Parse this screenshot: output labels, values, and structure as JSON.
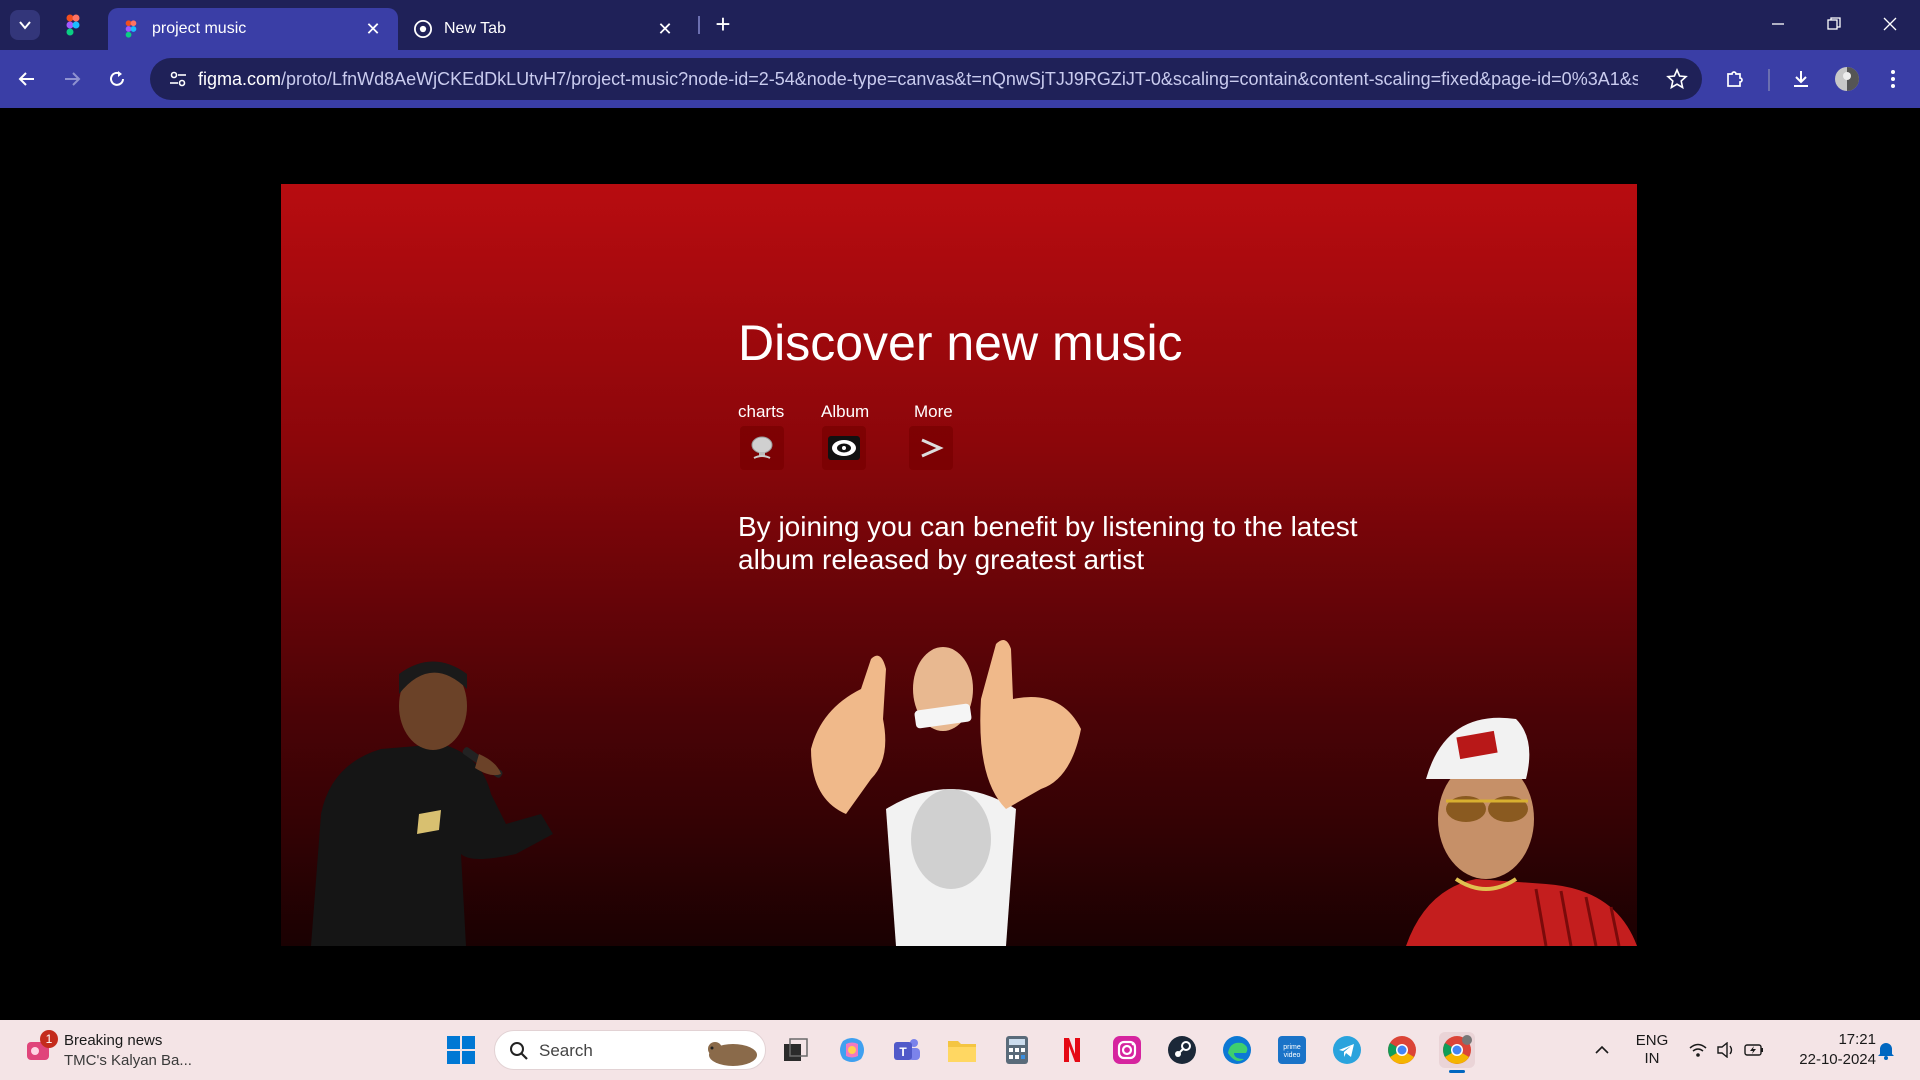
{
  "browser": {
    "tabs": [
      {
        "title": "project music",
        "active": true
      },
      {
        "title": "New Tab",
        "active": false
      }
    ],
    "url_host": "figma.com",
    "url_path": "/proto/LfnWd8AeWjCKEdDkLUtvH7/project-music?node-id=2-54&node-type=canvas&t=nQnwSjTJJ9RGZiJT-0&scaling=contain&content-scaling=fixed&page-id=0%3A1&star..."
  },
  "page": {
    "headline": "Discover new music",
    "categories": [
      {
        "label": "charts",
        "icon": "microphone-icon"
      },
      {
        "label": "Album",
        "icon": "vinyl-disc-icon"
      },
      {
        "label": "More",
        "icon": "arrow-right-icon"
      }
    ],
    "blurb": "By joining you can benefit by listening to the latest album released by greatest artist"
  },
  "taskbar": {
    "news_badge": "1",
    "news_title": "Breaking news",
    "news_subtitle": "TMC's Kalyan Ba...",
    "search_label": "Search",
    "lang_line1": "ENG",
    "lang_line2": "IN",
    "time": "17:21",
    "date": "22-10-2024"
  },
  "colors": {
    "tabstrip": "#1f2158",
    "toolbar": "#3a3ea6",
    "frame_top": "#b80c10",
    "frame_bottom": "#1a0102"
  }
}
